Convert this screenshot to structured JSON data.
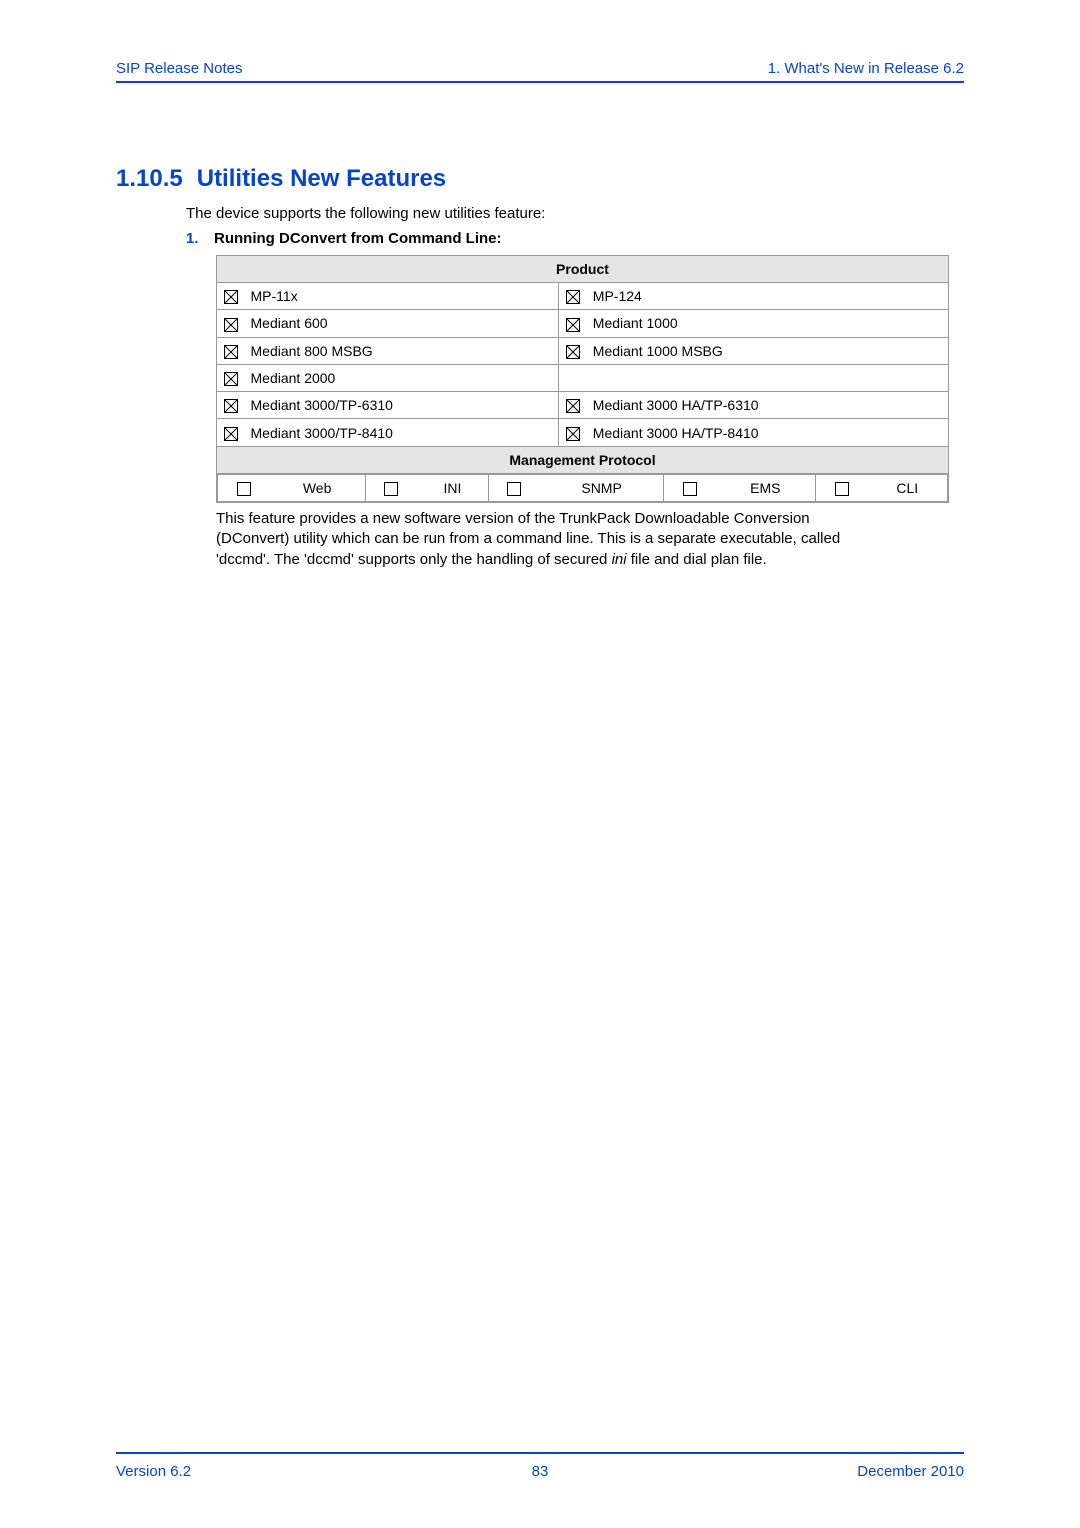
{
  "header": {
    "left": "SIP Release Notes",
    "right": "1. What's New in Release 6.2"
  },
  "section": {
    "number": "1.10.5",
    "title": "Utilities New Features",
    "intro": "The device supports the following new utilities feature:",
    "item_number": "1.",
    "item_label": "Running DConvert from Command Line:"
  },
  "table": {
    "product_header": "Product",
    "rows": [
      {
        "left_checked": true,
        "left_label": "MP-11x",
        "right_checked": true,
        "right_label": "MP-124"
      },
      {
        "left_checked": true,
        "left_label": "Mediant 600",
        "right_checked": true,
        "right_label": "Mediant 1000"
      },
      {
        "left_checked": true,
        "left_label": "Mediant 800 MSBG",
        "right_checked": true,
        "right_label": "Mediant 1000 MSBG"
      },
      {
        "left_checked": true,
        "left_label": "Mediant 2000",
        "right_checked": null,
        "right_label": ""
      },
      {
        "left_checked": true,
        "left_label": "Mediant 3000/TP-6310",
        "right_checked": true,
        "right_label": "Mediant 3000 HA/TP-6310"
      },
      {
        "left_checked": true,
        "left_label": "Mediant 3000/TP-8410",
        "right_checked": true,
        "right_label": "Mediant 3000 HA/TP-8410"
      }
    ],
    "mgmt_header": "Management Protocol",
    "mgmt": [
      {
        "checked": false,
        "label": "Web"
      },
      {
        "checked": false,
        "label": "INI"
      },
      {
        "checked": false,
        "label": "SNMP"
      },
      {
        "checked": false,
        "label": "EMS"
      },
      {
        "checked": false,
        "label": "CLI"
      }
    ]
  },
  "description": {
    "p1a": "This feature provides a new software version of the TrunkPack Downloadable Conversion (DConvert) utility which can be run from a command line. This is a separate executable, called 'dccmd'. The 'dccmd' supports only the handling of secured ",
    "p1_em": "ini",
    "p1b": " file and dial plan file."
  },
  "footer": {
    "left": "Version 6.2",
    "center": "83",
    "right": "December 2010"
  }
}
